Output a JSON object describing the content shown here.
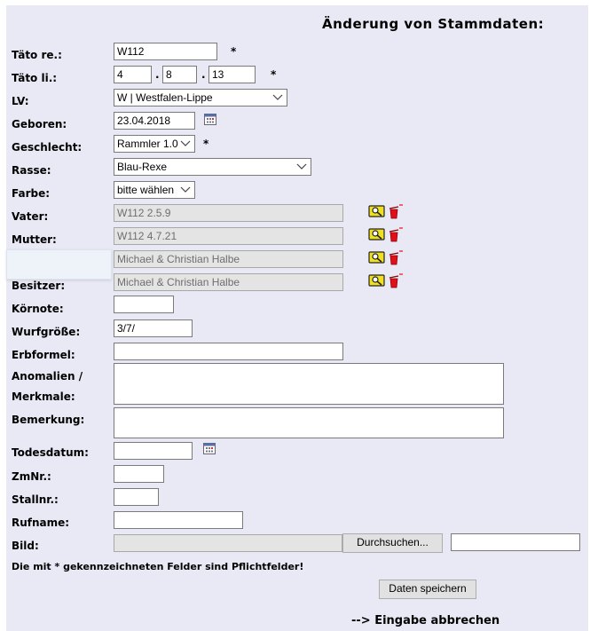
{
  "title": "Änderung von Stammdaten:",
  "labels": {
    "taeto_re": "Täto re.:",
    "taeto_li": "Täto li.:",
    "lv": "LV:",
    "geboren": "Geboren:",
    "geschlecht": "Geschlecht:",
    "rasse": "Rasse:",
    "farbe": "Farbe:",
    "vater": "Vater:",
    "mutter": "Mutter:",
    "besitzer": "Besitzer:",
    "koernote": "Körnote:",
    "wurfgroesse": "Wurfgröße:",
    "erbformel": "Erbformel:",
    "anomalien_1": "Anomalien /",
    "anomalien_2": "Merkmale:",
    "bemerkung": "Bemerkung:",
    "todesdatum": "Todesdatum:",
    "zmnr": "ZmNr.:",
    "stallnr": "Stallnr.:",
    "rufname": "Rufname:",
    "bild": "Bild:"
  },
  "fields": {
    "taeto_re": "W112",
    "taeto_li_1": "4",
    "taeto_li_2": "8",
    "taeto_li_3": "13",
    "taeto_li_sep": ".",
    "lv": "W | Westfalen-Lippe",
    "geboren": "23.04.2018",
    "geschlecht": "Rammler 1.0",
    "rasse": "Blau-Rexe",
    "farbe": "bitte wählen",
    "vater": "W112 2.5.9",
    "mutter": "W112 4.7.21",
    "zuechter": "Michael & Christian Halbe",
    "besitzer": "Michael & Christian Halbe",
    "koernote": "",
    "wurfgroesse": "3/7/",
    "erbformel": "",
    "anomalien": "",
    "bemerkung": "",
    "todesdatum": "",
    "zmnr": "",
    "stallnr": "",
    "rufname": "",
    "bild": "",
    "bild_name": ""
  },
  "required_marker": "*",
  "buttons": {
    "browse": "Durchsuchen...",
    "save": "Daten speichern"
  },
  "note": "Die mit * gekennzeichneten Felder sind Pflichtfelder!",
  "cancel": "--> Eingabe abbrechen",
  "icons": {
    "search": "search-icon",
    "delete": "delete-icon",
    "calendar": "calendar-icon"
  },
  "colors": {
    "page_bg": "#e9e9f6",
    "readonly_bg": "#e4e4e4",
    "icon_yellow": "#f0e020",
    "icon_red": "#e0101a"
  }
}
